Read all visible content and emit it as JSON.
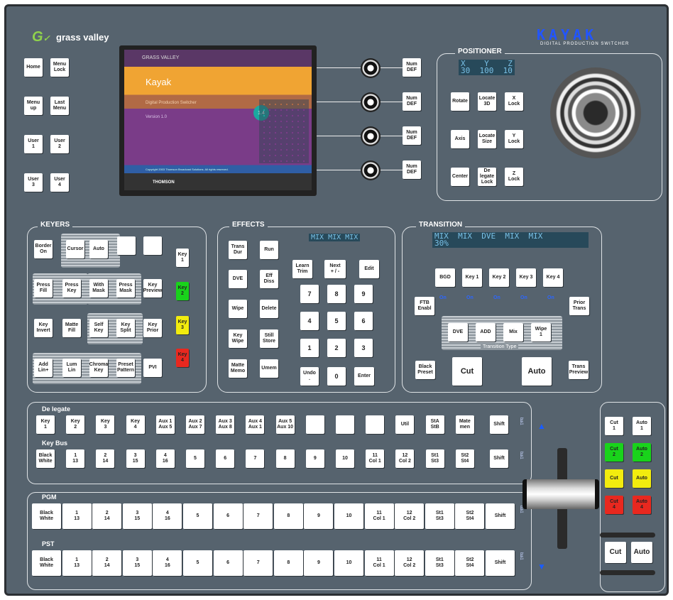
{
  "brand": {
    "logo_text": "grass valley",
    "product": "KAYAK",
    "product_sub": "DIGITAL PRODUCTION SWITCHER"
  },
  "menu_buttons": [
    {
      "id": "home",
      "label": "Home"
    },
    {
      "id": "menu-lock",
      "label": "Menu\nLock"
    },
    {
      "id": "menu-up",
      "label": "Menu\nup"
    },
    {
      "id": "last-menu",
      "label": "Last\nMenu"
    },
    {
      "id": "user1",
      "label": "User\n1"
    },
    {
      "id": "user2",
      "label": "User\n2"
    },
    {
      "id": "user3",
      "label": "User\n3"
    },
    {
      "id": "user4",
      "label": "User\n4"
    }
  ],
  "screen": {
    "header": "GRASS VALLEY",
    "title": "Kayak",
    "subtitle": "Digital Production Switcher",
    "version": "Version 1.0",
    "badge": "1.4",
    "copyright": "Copyright 2003 Thomson Broadcast Solutions. All rights reserved.",
    "footer": "THOMSON"
  },
  "num_def": [
    "Num\nDEF",
    "Num\nDEF",
    "Num\nDEF",
    "Num\nDEF"
  ],
  "positioner": {
    "title": "POSITIONER",
    "lcd": "X    Y    Z\n30  100  10",
    "buttons": [
      "Rotate",
      "Locate\n3D",
      "X\nLock",
      "Axis",
      "Locate\nSize",
      "Y\nLock",
      "Center",
      "De legate\nLock",
      "Z\nLock"
    ]
  },
  "keyers": {
    "title": "KEYERS",
    "row1": [
      "Border\nOn",
      "Cursor",
      "Auto"
    ],
    "key1": "Key\n1",
    "row2": [
      "Press\nFill",
      "Press\nKey",
      "With\nMask",
      "Press\nMask",
      "Key\nPreview"
    ],
    "key2": "Key\n2",
    "row3": [
      "Key\nInvert",
      "Matte\nFill",
      "Self\nKey",
      "Key\nSplit",
      "Key\nPrior"
    ],
    "key3": "Key\n3",
    "row4": [
      "Add\nLin+",
      "Lum\nLin",
      "Chroma\nKey",
      "Preset\nPattern",
      "PVI"
    ],
    "key4": "Key\n4"
  },
  "effects": {
    "title": "EFFECTS",
    "lcd": "MIX MIX MIX",
    "left": [
      "Trans\nDur",
      "DVE",
      "Wipe",
      "Key\nWipe",
      "Matte\nMemo"
    ],
    "mid": [
      "Run",
      "Eff\nDiss",
      "Delete",
      "Still\nStore",
      "Umem"
    ],
    "learn": "Learn\nTrim",
    "next": "Next\n+ / -",
    "edit": "Edit",
    "keypad": [
      "7",
      "8",
      "9",
      "4",
      "5",
      "6",
      "1",
      "2",
      "3"
    ],
    "undo": "Undo\n.",
    "zero": "0",
    "enter": "Enter"
  },
  "transition": {
    "title": "TRANSITION",
    "lcd": "MIX  MIX  DVE  MIX  MIX\n30%",
    "ftb": "FTB\nEnabl",
    "row": [
      "BGD",
      "Key 1",
      "Key 2",
      "Key 3",
      "Key 4"
    ],
    "on": [
      "On",
      "On",
      "On",
      "On",
      "On"
    ],
    "prior": "Prior\nTrans",
    "types": [
      "DVE",
      "ADD",
      "Mix",
      "Wipe\n1"
    ],
    "type_caption": "Transition Type",
    "black_preset": "Black\nPreset",
    "cut": "Cut",
    "auto": "Auto",
    "trans_preview": "Trans\nPreview"
  },
  "delegate": {
    "title": "De legate",
    "buttons": [
      "Key\n1",
      "Key\n2",
      "Key\n3",
      "Key\n4",
      "Aux 1\nAux 5",
      "Aux 2\nAux 7",
      "Aux 3\nAux 8",
      "Aux 4\nAux 1",
      "Aux 5\nAux 10",
      "",
      "",
      "",
      "Util",
      "StA\nStB",
      "Mate\nmen",
      "Shift"
    ],
    "side": "bus 1"
  },
  "keybus": {
    "title": "Key Bus",
    "buttons": [
      "Black\nWhite",
      "1\n13",
      "2\n14",
      "3\n15",
      "4\n16",
      "5",
      "6",
      "7",
      "8",
      "9",
      "10",
      "11\nCol 1",
      "12\nCol 2",
      "St1\nSt3",
      "St2\nSt4",
      "Shift"
    ],
    "side": "bus 1"
  },
  "pgm": {
    "title": "PGM",
    "buttons": [
      "Black\nWhite",
      "1\n13",
      "2\n14",
      "3\n15",
      "4\n16",
      "5",
      "6",
      "7",
      "8",
      "9",
      "10",
      "11\nCol 1",
      "12\nCol 2",
      "St1\nSt3",
      "St2\nSt4",
      "Shift"
    ],
    "side": "bus 1"
  },
  "pst": {
    "title": "PST",
    "buttons": [
      "Black\nWhite",
      "1\n13",
      "2\n14",
      "3\n15",
      "4\n16",
      "5",
      "6",
      "7",
      "8",
      "9",
      "10",
      "11\nCol 1",
      "12\nCol 2",
      "St1\nSt3",
      "St2\nSt4",
      "Shift"
    ],
    "side": "bus 1"
  },
  "right_panel": {
    "rows": [
      [
        "Cut\n1",
        "Auto\n1"
      ],
      [
        "Cut\n2",
        "Auto\n2"
      ],
      [
        "Cut",
        "Auto"
      ],
      [
        "Cut\n4",
        "Auto\n4"
      ]
    ],
    "cut": "Cut",
    "auto": "Auto"
  },
  "colors": {
    "panel": "#56636e",
    "green": "#19d31b",
    "yellow": "#f2ec0e",
    "red": "#e8281f",
    "lcd_bg": "#27495a",
    "lcd_text": "#79c0e6",
    "on_text": "#2c67ff"
  }
}
